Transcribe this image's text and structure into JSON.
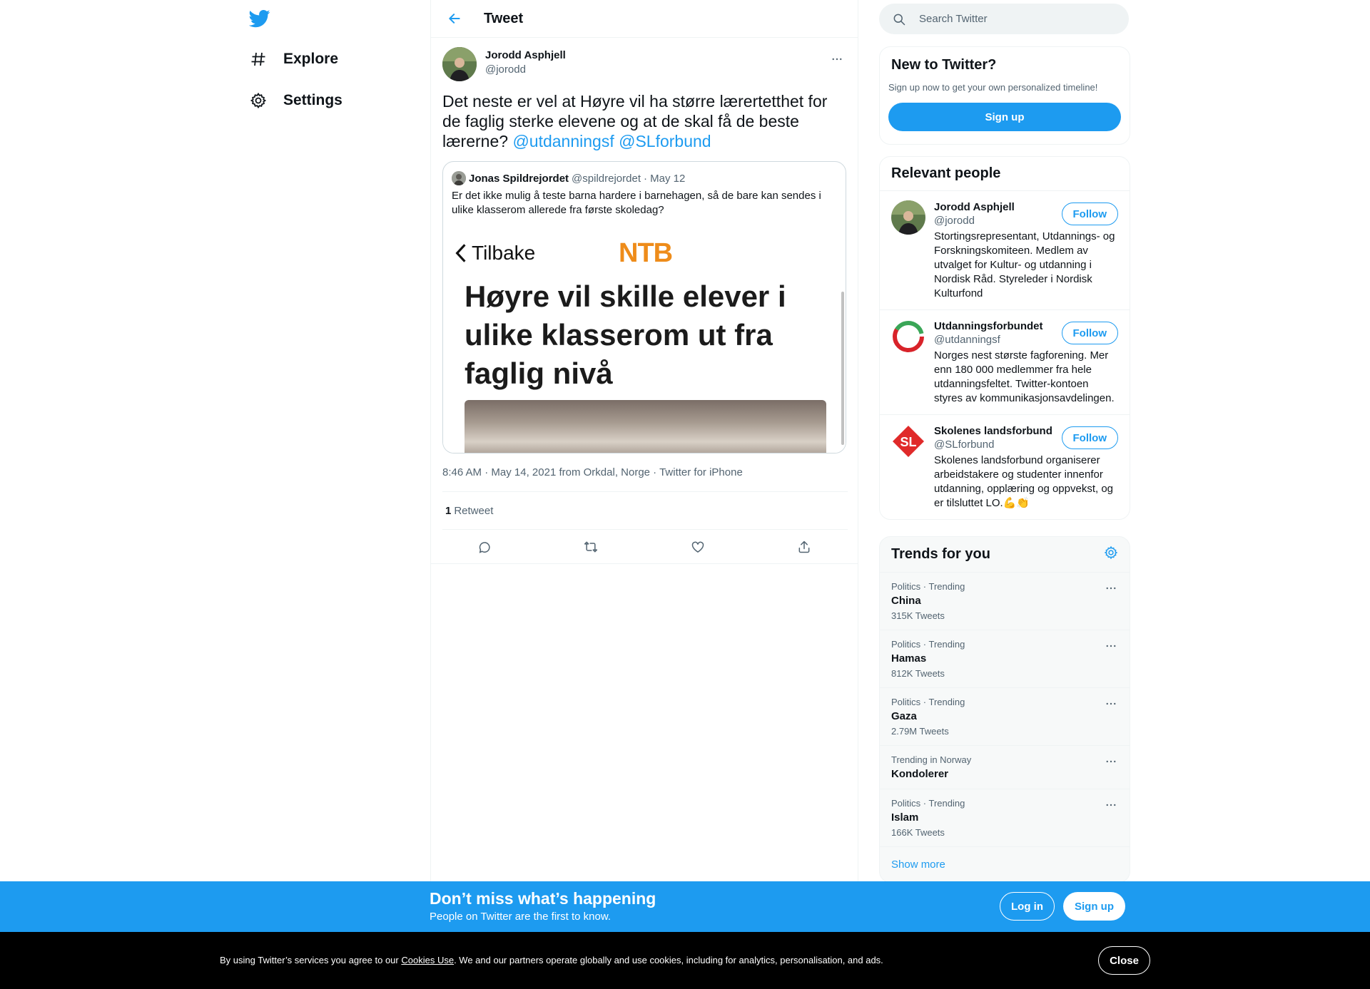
{
  "nav": {
    "logo_icon": "twitter-bird-icon",
    "items": [
      {
        "label": "Explore",
        "icon": "hashtag-icon"
      },
      {
        "label": "Settings",
        "icon": "gear-icon"
      }
    ]
  },
  "header": {
    "title": "Tweet",
    "back_icon": "arrow-left-icon"
  },
  "tweet": {
    "author_name": "Jorodd Asphjell",
    "author_handle": "@jorodd",
    "text": "Det neste er vel at Høyre vil ha større lærertetthet for de faglig sterke elevene og at de skal få de beste lærerne? ",
    "mentions": [
      "@utdanningsf",
      "@SLforbund"
    ],
    "quote": {
      "name": "Jonas Spildrejordet",
      "handle": "@spildrejordet",
      "date": "· May 12",
      "text": "Er det ikke mulig å teste barna hardere i barnehagen, så de bare kan sendes i ulike klasserom allerede fra første skoledag?",
      "image": {
        "back_label": "Tilbake",
        "brand": "NTB",
        "headline": "Høyre vil skille elever i ulike klasserom ut fra faglig nivå"
      }
    },
    "time": "8:46 AM",
    "date": "May 14, 2021",
    "location_prefix": "from",
    "location": "Orkdal, Norge",
    "source": "Twitter for iPhone",
    "retweet_count": "1",
    "retweet_label": "Retweet"
  },
  "search": {
    "placeholder": "Search Twitter"
  },
  "new_to_twitter": {
    "title": "New to Twitter?",
    "subtitle": "Sign up now to get your own personalized timeline!",
    "button": "Sign up"
  },
  "relevant_people": {
    "title": "Relevant people",
    "people": [
      {
        "name": "Jorodd Asphjell",
        "handle": "@jorodd",
        "follow": "Follow",
        "bio": "Stortingsrepresentant, Utdannings- og Forskningskomiteen. Medlem av utvalget for Kultur- og utdanning i Nordisk Råd. Styreleder i Nordisk Kulturfond"
      },
      {
        "name": "Utdanningsforbundet",
        "handle": "@utdanningsf",
        "follow": "Follow",
        "bio": "Norges nest største fagforening. Mer enn 180 000 medlemmer fra hele utdanningsfeltet. Twitter-kontoen styres av kommunikasjonsavdelingen."
      },
      {
        "name": "Skolenes landsforbund",
        "handle": "@SLforbund",
        "follow": "Follow",
        "bio": "Skolenes landsforbund organiserer arbeidstakere og studenter innenfor utdanning, opplæring og oppvekst, og er tilsluttet LO.💪👏"
      }
    ]
  },
  "trends": {
    "title": "Trends for you",
    "items": [
      {
        "meta": "Politics · Trending",
        "name": "China",
        "count": "315K Tweets"
      },
      {
        "meta": "Politics · Trending",
        "name": "Hamas",
        "count": "812K Tweets"
      },
      {
        "meta": "Politics · Trending",
        "name": "Gaza",
        "count": "2.79M Tweets"
      },
      {
        "meta": "Trending in Norway",
        "name": "Kondolerer",
        "count": ""
      },
      {
        "meta": "Politics · Trending",
        "name": "Islam",
        "count": "166K Tweets"
      }
    ],
    "show_more": "Show more"
  },
  "promo": {
    "title": "Don’t miss what’s happening",
    "subtitle": "People on Twitter are the first to know.",
    "login": "Log in",
    "signup": "Sign up"
  },
  "cookie": {
    "text_before": "By using Twitter’s services you agree to our ",
    "link": "Cookies Use",
    "text_after": ". We and our partners operate globally and use cookies, including for analytics, personalisation, and ads.",
    "close": "Close"
  },
  "colors": {
    "accent": "#1d9bf0",
    "text": "#0f1419",
    "muted": "#536471",
    "border": "#eff3f4"
  }
}
